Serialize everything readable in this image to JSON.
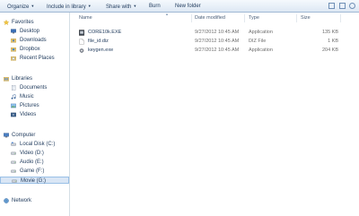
{
  "toolbar": {
    "organize": "Organize",
    "include_in_library": "Include in library",
    "share_with": "Share with",
    "burn": "Burn",
    "new_folder": "New folder"
  },
  "nav": {
    "favorites": {
      "label": "Favorites",
      "items": [
        "Desktop",
        "Downloads",
        "Dropbox",
        "Recent Places"
      ]
    },
    "libraries": {
      "label": "Libraries",
      "items": [
        "Documents",
        "Music",
        "Pictures",
        "Videos"
      ]
    },
    "computer": {
      "label": "Computer",
      "items": [
        "Local Disk (C:)",
        "Video (D:)",
        "Audio (E:)",
        "Game (F:)",
        "Movie (G:)"
      ],
      "selected_index": 4
    },
    "network": {
      "label": "Network"
    }
  },
  "list": {
    "columns": [
      "Name",
      "Date modified",
      "Type",
      "Size"
    ],
    "files": [
      {
        "name": "CORE10k.EXE",
        "date": "9/27/2012 10:45 AM",
        "type": "Application",
        "size": "135 KB",
        "icon": "exe-icon"
      },
      {
        "name": "file_id.diz",
        "date": "9/27/2012 10:45 AM",
        "type": "DIZ File",
        "size": "1 KB",
        "icon": "document-icon"
      },
      {
        "name": "keygen.exe",
        "date": "9/27/2012 10:45 AM",
        "type": "Application",
        "size": "204 KB",
        "icon": "gear-icon"
      }
    ]
  }
}
